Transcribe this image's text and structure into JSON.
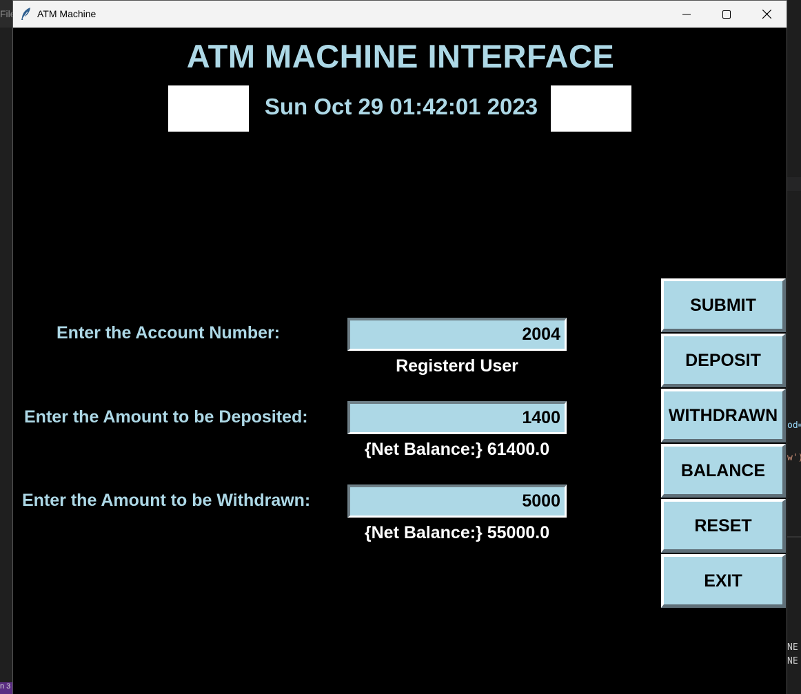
{
  "background": {
    "left_menu_text": "File",
    "bottom_left_text": "n 3",
    "right_code_fragments": [
      "od=",
      "w')",
      "NE",
      "NE"
    ]
  },
  "window": {
    "title": "ATM Machine",
    "controls": [
      "minimize",
      "maximize",
      "close"
    ]
  },
  "header": {
    "title": "ATM MACHINE INTERFACE",
    "datetime": "Sun Oct 29 01:42:01 2023"
  },
  "form": {
    "account": {
      "label": "Enter the Account Number:",
      "value": "2004",
      "status": "Registerd User"
    },
    "deposit": {
      "label": "Enter the Amount to be Deposited:",
      "value": "1400",
      "status": "{Net Balance:} 61400.0"
    },
    "withdraw": {
      "label": "Enter the Amount to be Withdrawn:",
      "value": "5000",
      "status": "{Net Balance:} 55000.0"
    }
  },
  "buttons": {
    "submit": "SUBMIT",
    "deposit": "DEPOSIT",
    "withdrawn": "WITHDRAWN",
    "balance": "BALANCE",
    "reset": "RESET",
    "exit": "EXIT"
  },
  "colors": {
    "accent": "#add8e6",
    "background": "#000000",
    "status_text": "#ffffff"
  }
}
